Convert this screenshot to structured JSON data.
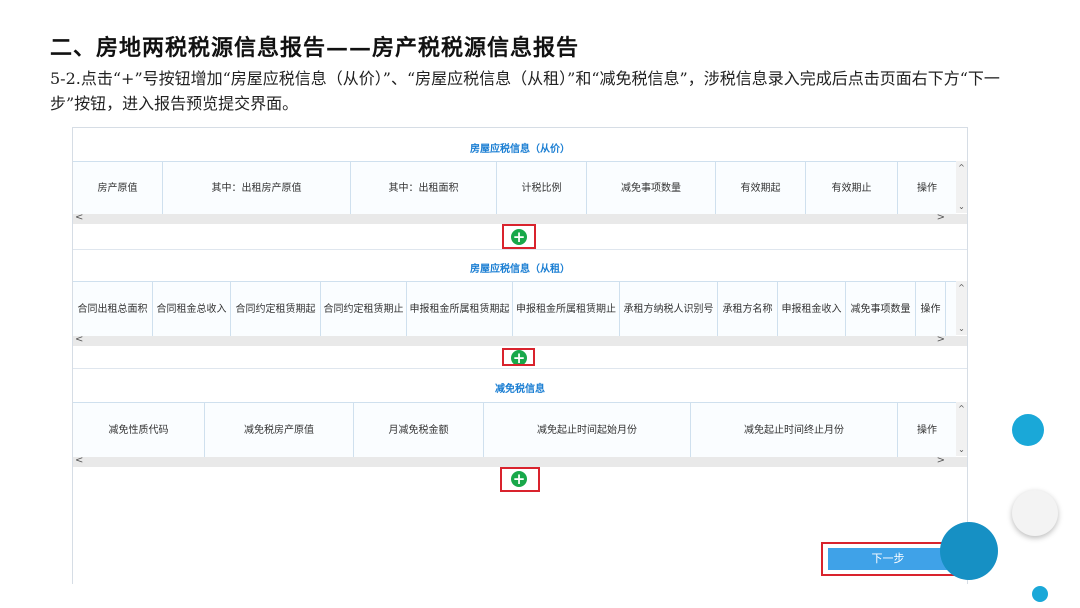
{
  "slide": {
    "title": "二、房地两税税源信息报告——房产税税源信息报告",
    "description": "5-2.点击“+”号按钮增加“房屋应税信息（从价）”、“房屋应税信息（从租）”和“减免税信息”，涉税信息录入完成后点击页面右下方“下一步”按钮，进入报告预览提交界面。"
  },
  "section_price": {
    "title": "房屋应税信息（从价）",
    "columns": [
      "房产原值",
      "其中：出租房产原值",
      "其中：出租面积",
      "计税比例",
      "减免事项数量",
      "有效期起",
      "有效期止",
      "操作"
    ]
  },
  "section_rent": {
    "title": "房屋应税信息（从租）",
    "columns": [
      "合同出租总面积",
      "合同租金总收入",
      "合同约定租赁期起",
      "合同约定租赁期止",
      "申报租金所属租赁期起",
      "申报租金所属租赁期止",
      "承租方纳税人识别号",
      "承租方名称",
      "申报租金收入",
      "减免事项数量",
      "操作"
    ]
  },
  "section_relief": {
    "title": "减免税信息",
    "columns": [
      "减免性质代码",
      "减免税房产原值",
      "月减免税金额",
      "减免起止时间起始月份",
      "减免起止时间终止月份",
      "操作"
    ]
  },
  "controls": {
    "add_symbol": "+",
    "next_label": "下一步",
    "scroll_up": "^",
    "scroll_down": "⌄",
    "scroll_left": "<",
    "scroll_right": ">"
  },
  "colors": {
    "section_title": "#1c7fd3",
    "add_button": "#18a84a",
    "highlight": "#d9232d",
    "next_button": "#3fa2e8"
  }
}
